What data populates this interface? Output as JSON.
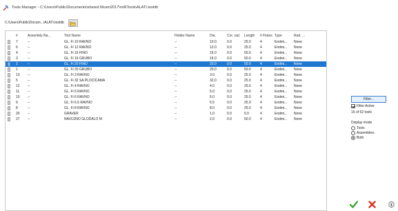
{
  "window": {
    "title": "Tools Manager - C:\\Users\\Public\\Documents\\shared Mcam2017\\mill\\Tools\\ALATI.tooldb"
  },
  "pathbar": {
    "path": "C:\\Users\\Public\\Docum...\\ALATI.tooldb"
  },
  "grid": {
    "headers": {
      "num": "#",
      "assembly": "Assembly Na...",
      "tool_name": "Tool Name",
      "holder": "Holder Name",
      "dia": "Dia.",
      "cor_rad": "Cor. rad.",
      "length": "Length",
      "flutes": "# Flutes",
      "type": "Type",
      "rad": "Rad. ..."
    },
    "rows": [
      {
        "num": "7",
        "assembly": "--",
        "tool_name": "GL. Fi 10 RAVNO",
        "holder": "--",
        "dia": "10.0",
        "cor_rad": "0.0",
        "length": "25.0",
        "flutes": "4",
        "type": "Endmi...",
        "rad": "None",
        "selected": false
      },
      {
        "num": "6",
        "assembly": "--",
        "tool_name": "GL. Fi 12 RAVNO",
        "holder": "--",
        "dia": "12.0",
        "cor_rad": "0.0",
        "length": "25.0",
        "flutes": "4",
        "type": "Endmi...",
        "rad": "None",
        "selected": false
      },
      {
        "num": "4",
        "assembly": "--",
        "tool_name": "GL. Fi 16 FINO",
        "holder": "--",
        "dia": "16.0",
        "cor_rad": "0.0",
        "length": "50.0",
        "flutes": "4",
        "type": "Endmi...",
        "rad": "None",
        "selected": false
      },
      {
        "num": "3",
        "assembly": "--",
        "tool_name": "GL. Fi 16 GRUBO",
        "holder": "--",
        "dia": "16.0",
        "cor_rad": "0.0",
        "length": "50.0",
        "flutes": "4",
        "type": "Endmi...",
        "rad": "None",
        "selected": false
      },
      {
        "num": "2",
        "assembly": "--",
        "tool_name": "GL. Fi 20 FINO",
        "holder": "--",
        "dia": "20.0",
        "cor_rad": "0.0",
        "length": "50.0",
        "flutes": "4",
        "type": "Endmi...",
        "rad": "None",
        "selected": true
      },
      {
        "num": "1",
        "assembly": "--",
        "tool_name": "GL. Fi 20 GRUBO",
        "holder": "--",
        "dia": "20.0",
        "cor_rad": "0.0",
        "length": "50.0",
        "flutes": "4",
        "type": "Endmi...",
        "rad": "None",
        "selected": false
      },
      {
        "num": "13",
        "assembly": "--",
        "tool_name": "GL. Fi 3 RAVNO",
        "holder": "--",
        "dia": "3.0",
        "cor_rad": "0.0",
        "length": "25.0",
        "flutes": "4",
        "type": "Endmi...",
        "rad": "None",
        "selected": false
      },
      {
        "num": "5",
        "assembly": "--",
        "tool_name": "GL. Fi 32 SA PLOCICAMA",
        "holder": "--",
        "dia": "32.0",
        "cor_rad": "0.0",
        "length": "25.0",
        "flutes": "4",
        "type": "Endmi...",
        "rad": "None",
        "selected": false
      },
      {
        "num": "12",
        "assembly": "--",
        "tool_name": "GL. Fi 4 RAVNO",
        "holder": "--",
        "dia": "4.0",
        "cor_rad": "0.0",
        "length": "25.0",
        "flutes": "4",
        "type": "Endmi...",
        "rad": "None",
        "selected": false
      },
      {
        "num": "11",
        "assembly": "--",
        "tool_name": "GL. Fi 5 RAVNO",
        "holder": "--",
        "dia": "5.0",
        "cor_rad": "0.0",
        "length": "25.0",
        "flutes": "4",
        "type": "Endmi...",
        "rad": "None",
        "selected": false
      },
      {
        "num": "10",
        "assembly": "--",
        "tool_name": "GL. Fi 6 RAVNO",
        "holder": "--",
        "dia": "6.0",
        "cor_rad": "0.0",
        "length": "25.0",
        "flutes": "4",
        "type": "Endmi...",
        "rad": "None",
        "selected": false
      },
      {
        "num": "9",
        "assembly": "--",
        "tool_name": "GL. Fi 6.5 RAVNO",
        "holder": "--",
        "dia": "6.5",
        "cor_rad": "0.0",
        "length": "25.0",
        "flutes": "4",
        "type": "Endmi...",
        "rad": "None",
        "selected": false
      },
      {
        "num": "8",
        "assembly": "--",
        "tool_name": "GL. Fi 8 RAVNO",
        "holder": "--",
        "dia": "8.0",
        "cor_rad": "0.0",
        "length": "25.0",
        "flutes": "4",
        "type": "Endmi...",
        "rad": "None",
        "selected": false
      },
      {
        "num": "20",
        "assembly": "--",
        "tool_name": "GRAVER",
        "holder": "--",
        "dia": "1.0",
        "cor_rad": "0.0",
        "length": "5.0",
        "flutes": "4",
        "type": "Endmi...",
        "rad": "None",
        "selected": false
      },
      {
        "num": "27",
        "assembly": "--",
        "tool_name": "NAVOJNO GLODALO M",
        "holder": "--",
        "dia": "2.0",
        "cor_rad": "0.0",
        "length": "50.0",
        "flutes": "4",
        "type": "Endmi...",
        "rad": "None",
        "selected": false
      }
    ]
  },
  "sidebar": {
    "filter_label": "Filter...",
    "filter_active_label": "Filter Active",
    "filter_active_checked": true,
    "count_text": "15 of 52 tools",
    "display_mode_title": "Display mode",
    "display_options": [
      {
        "label": "Tools",
        "selected": false
      },
      {
        "label": "Assemblies",
        "selected": false
      },
      {
        "label": "Both",
        "selected": true
      }
    ]
  },
  "footer": {
    "ok_color": "#3aa52b",
    "cancel_color": "#d9301f"
  },
  "icons": {
    "app": "tools-manager-icon",
    "folder": "open-folder-icon",
    "ok": "checkmark-icon",
    "cancel": "x-icon",
    "help": "help-icon"
  }
}
